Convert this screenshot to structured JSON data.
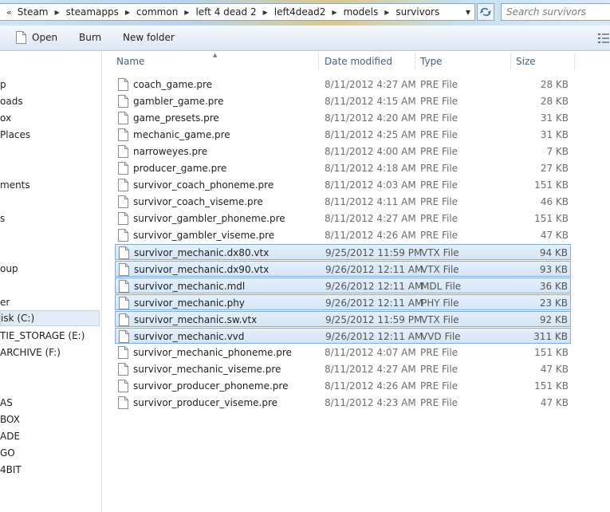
{
  "address_bar": {
    "crumbs": [
      "Steam",
      "steamapps",
      "common",
      "left 4 dead 2",
      "left4dead2",
      "models",
      "survivors"
    ]
  },
  "search": {
    "placeholder": "Search survivors"
  },
  "toolbar": {
    "open": "Open",
    "burn": "Burn",
    "new_folder": "New folder"
  },
  "nav": {
    "items": [
      {
        "label": "p"
      },
      {
        "label": "oads"
      },
      {
        "label": "ox"
      },
      {
        "label": " Places"
      },
      {
        "label": "ments"
      },
      {
        "label": "s"
      },
      {
        "label": "oup"
      },
      {
        "label": "er"
      },
      {
        "label": "isk (C:)",
        "selected": true
      },
      {
        "label": "TIE_STORAGE (E:)"
      },
      {
        "label": " ARCHIVE (F:)"
      },
      {
        "label": "AS"
      },
      {
        "label": "BOX"
      },
      {
        "label": "ADE"
      },
      {
        "label": "GO"
      },
      {
        "label": "4BIT"
      }
    ]
  },
  "columns": {
    "name": "Name",
    "date": "Date modified",
    "type": "Type",
    "size": "Size"
  },
  "files": [
    {
      "name": "coach_game.pre",
      "date": "8/11/2012 4:27 AM",
      "type": "PRE File",
      "size": "28 KB",
      "selected": false
    },
    {
      "name": "gambler_game.pre",
      "date": "8/11/2012 4:15 AM",
      "type": "PRE File",
      "size": "28 KB",
      "selected": false
    },
    {
      "name": "game_presets.pre",
      "date": "8/11/2012 4:20 AM",
      "type": "PRE File",
      "size": "31 KB",
      "selected": false
    },
    {
      "name": "mechanic_game.pre",
      "date": "8/11/2012 4:25 AM",
      "type": "PRE File",
      "size": "31 KB",
      "selected": false
    },
    {
      "name": "narroweyes.pre",
      "date": "8/11/2012 4:00 AM",
      "type": "PRE File",
      "size": "7 KB",
      "selected": false
    },
    {
      "name": "producer_game.pre",
      "date": "8/11/2012 4:18 AM",
      "type": "PRE File",
      "size": "27 KB",
      "selected": false
    },
    {
      "name": "survivor_coach_phoneme.pre",
      "date": "8/11/2012 4:03 AM",
      "type": "PRE File",
      "size": "151 KB",
      "selected": false
    },
    {
      "name": "survivor_coach_viseme.pre",
      "date": "8/11/2012 4:11 AM",
      "type": "PRE File",
      "size": "46 KB",
      "selected": false
    },
    {
      "name": "survivor_gambler_phoneme.pre",
      "date": "8/11/2012 4:27 AM",
      "type": "PRE File",
      "size": "151 KB",
      "selected": false
    },
    {
      "name": "survivor_gambler_viseme.pre",
      "date": "8/11/2012 4:26 AM",
      "type": "PRE File",
      "size": "47 KB",
      "selected": false
    },
    {
      "name": "survivor_mechanic.dx80.vtx",
      "date": "9/25/2012 11:59 PM",
      "type": "VTX File",
      "size": "94 KB",
      "selected": true
    },
    {
      "name": "survivor_mechanic.dx90.vtx",
      "date": "9/26/2012 12:11 AM",
      "type": "VTX File",
      "size": "93 KB",
      "selected": true
    },
    {
      "name": "survivor_mechanic.mdl",
      "date": "9/26/2012 12:11 AM",
      "type": "MDL File",
      "size": "36 KB",
      "selected": true
    },
    {
      "name": "survivor_mechanic.phy",
      "date": "9/26/2012 12:11 AM",
      "type": "PHY File",
      "size": "23 KB",
      "selected": true
    },
    {
      "name": "survivor_mechanic.sw.vtx",
      "date": "9/25/2012 11:59 PM",
      "type": "VTX File",
      "size": "92 KB",
      "selected": true
    },
    {
      "name": "survivor_mechanic.vvd",
      "date": "9/26/2012 12:11 AM",
      "type": "VVD File",
      "size": "311 KB",
      "selected": true
    },
    {
      "name": "survivor_mechanic_phoneme.pre",
      "date": "8/11/2012 4:07 AM",
      "type": "PRE File",
      "size": "151 KB",
      "selected": false
    },
    {
      "name": "survivor_mechanic_viseme.pre",
      "date": "8/11/2012 4:27 AM",
      "type": "PRE File",
      "size": "47 KB",
      "selected": false
    },
    {
      "name": "survivor_producer_phoneme.pre",
      "date": "8/11/2012 4:26 AM",
      "type": "PRE File",
      "size": "151 KB",
      "selected": false
    },
    {
      "name": "survivor_producer_viseme.pre",
      "date": "8/11/2012 4:23 AM",
      "type": "PRE File",
      "size": "47 KB",
      "selected": false
    }
  ]
}
